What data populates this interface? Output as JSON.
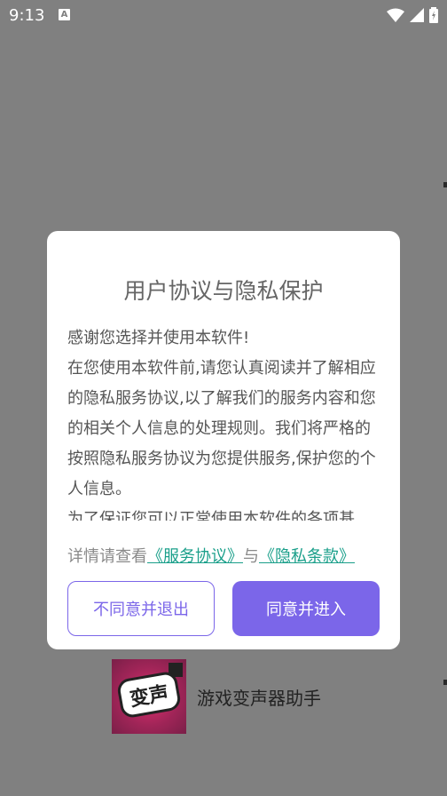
{
  "status_bar": {
    "time": "9:13",
    "notification_icon": "A"
  },
  "dialog": {
    "title": "用户协议与隐私保护",
    "body": [
      "感谢您选择并使用本软件!",
      "在您使用本软件前,请您认真阅读并了解相应的隐私服务协议,以了解我们的服务内容和您的相关个人信息的处理规则。我们将严格的按照隐私服务协议为您提供服务,保护您的个人信息。",
      "为了保证您可以正常使用本软件的各项基"
    ],
    "details_prefix": "详情请查看",
    "service_link": "《服务协议》",
    "joiner": "与",
    "privacy_link": "《隐私条款》",
    "decline_label": "不同意并退出",
    "accept_label": "同意并进入"
  },
  "app": {
    "name": "游戏变声器助手",
    "icon_text": "变声"
  },
  "colors": {
    "accent": "#7b66e9",
    "link": "#1a9f8a",
    "overlay": "#808080"
  }
}
